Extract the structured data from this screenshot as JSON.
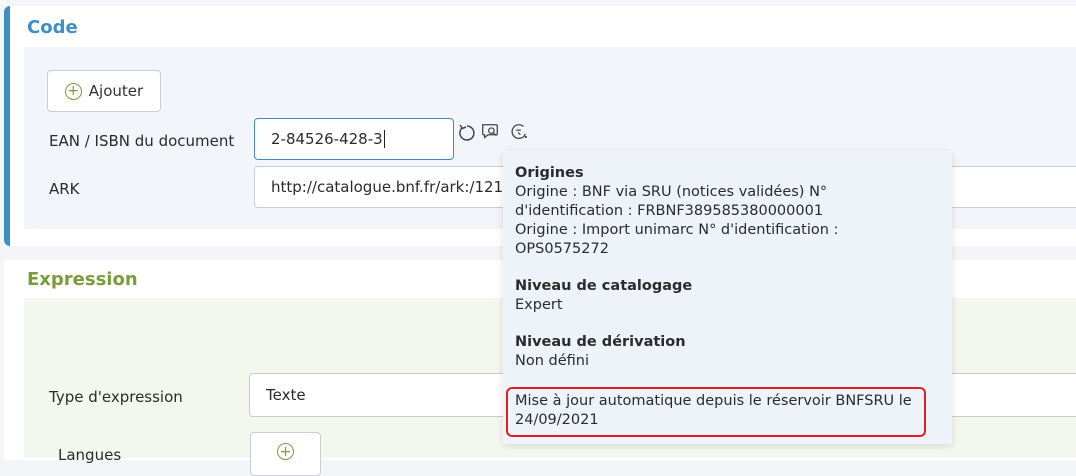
{
  "code_section": {
    "title": "Code",
    "add_label": "Ajouter",
    "ean_label": "EAN / ISBN du document",
    "ean_value": "2-84526-428-3",
    "ark_label": "ARK",
    "ark_value": "http://catalogue.bnf.fr/ark:/121"
  },
  "expression_section": {
    "title": "Expression",
    "type_label": "Type d'expression",
    "type_value": "Texte",
    "langues_label": "Langues"
  },
  "tooltip": {
    "origines_title": "Origines",
    "origine_1": "Origine : BNF via SRU (notices validées)  N° d'identification : FRBNF389585380000001",
    "origine_2": "Origine : Import unimarc  N° d'identification : OPS0575272",
    "niveau_catalogage_title": "Niveau de catalogage",
    "niveau_catalogage_value": "Expert",
    "niveau_derivation_title": "Niveau de dérivation",
    "niveau_derivation_value": "Non défini",
    "mise_a_jour": "Mise à jour automatique depuis le réservoir BNFSRU le 24/09/2021"
  },
  "icons": {
    "reset": "reset-icon",
    "origin_info": "search-comment-icon",
    "auto_update": "refresh-clock-icon",
    "add": "plus-circle-icon"
  },
  "colors": {
    "code_accent": "#3d8fc6",
    "expression_accent": "#7a9d3b",
    "highlight_border": "#e02020"
  }
}
